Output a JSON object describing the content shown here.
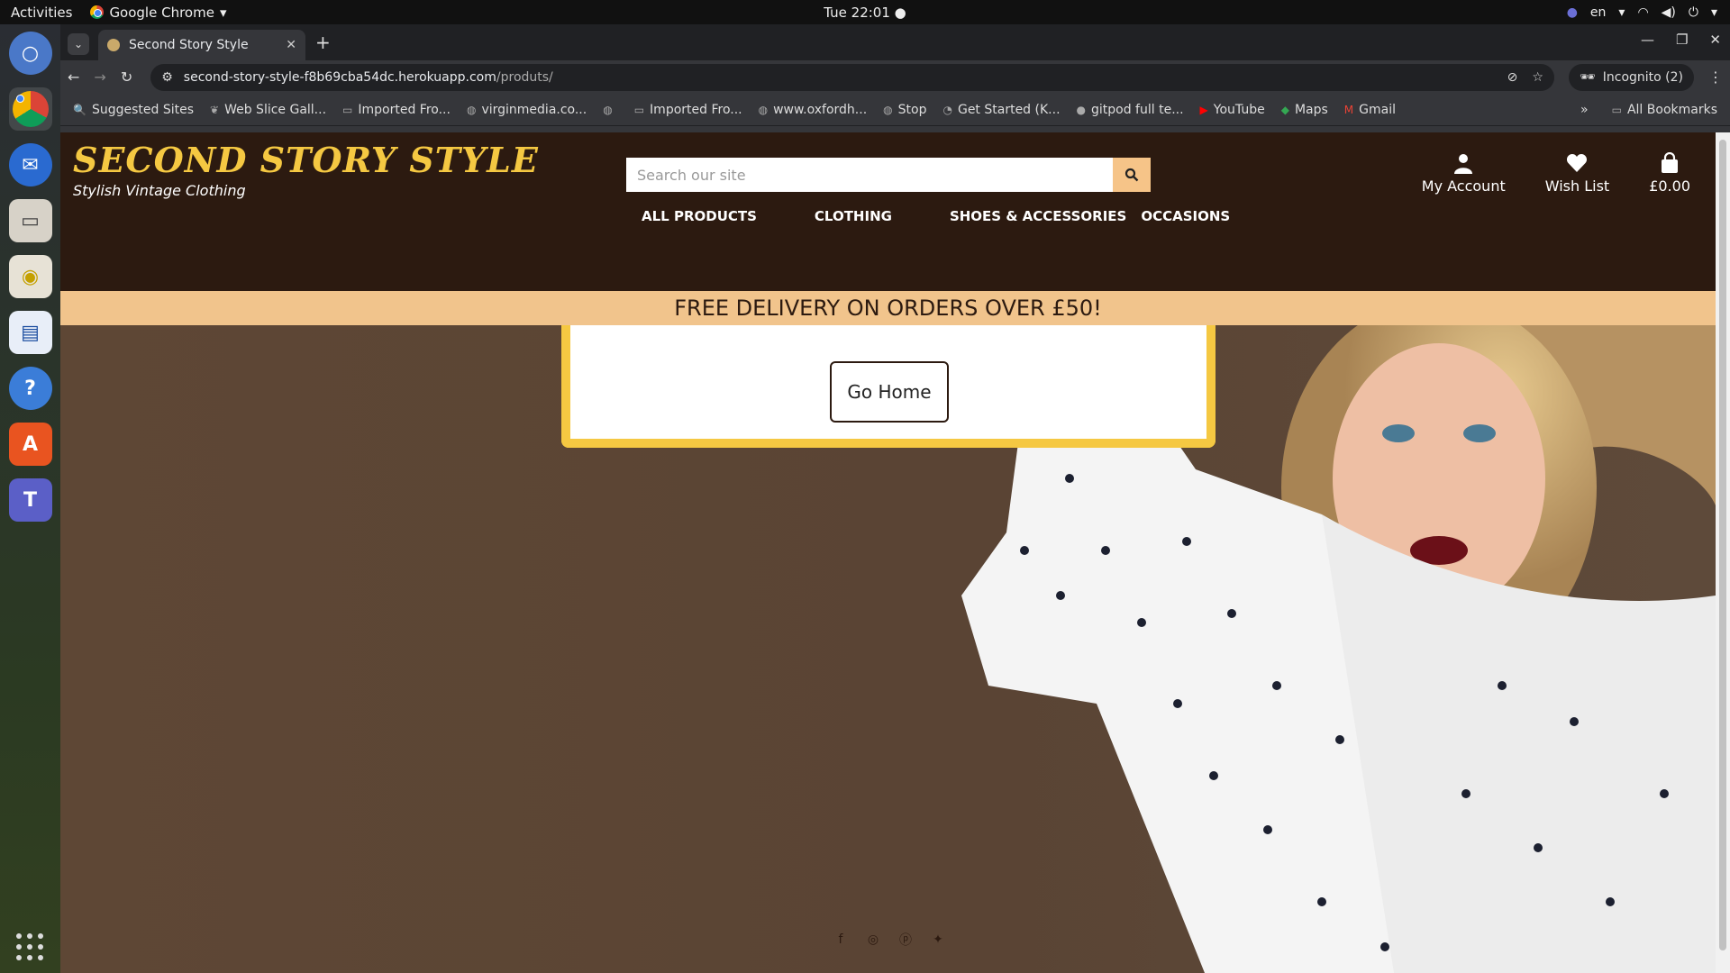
{
  "os": {
    "activities": "Activities",
    "app_name": "Google Chrome",
    "clock": "Tue 22:01",
    "lang": "en"
  },
  "browser": {
    "tab_title": "Second Story Style",
    "url_host": "second-story-style-f8b69cba54dc.herokuapp.com",
    "url_path": "/produts/",
    "incognito_label": "Incognito (2)",
    "bookmarks": [
      "Suggested Sites",
      "Web Slice Gall...",
      "Imported Fro...",
      "virginmedia.co...",
      "",
      "Imported Fro...",
      "www.oxfordh...",
      "Stop",
      "Get Started (K...",
      "gitpod full te...",
      "YouTube",
      "Maps",
      "Gmail"
    ],
    "all_bookmarks": "All Bookmarks"
  },
  "site": {
    "logo": "SECOND STORY STYLE",
    "tagline": "Stylish Vintage Clothing",
    "search_placeholder": "Search our site",
    "account": "My Account",
    "wishlist": "Wish List",
    "bag_total": "£0.00",
    "nav": [
      "ALL PRODUCTS",
      "CLOTHING",
      "SHOES & ACCESSORIES",
      "OCCASIONS"
    ],
    "banner": "FREE DELIVERY ON ORDERS OVER £50!",
    "go_home": "Go Home"
  },
  "colors": {
    "header_bg": "#2c1a10",
    "logo_yellow": "#f5c842",
    "banner_bg": "#f1c48c"
  }
}
